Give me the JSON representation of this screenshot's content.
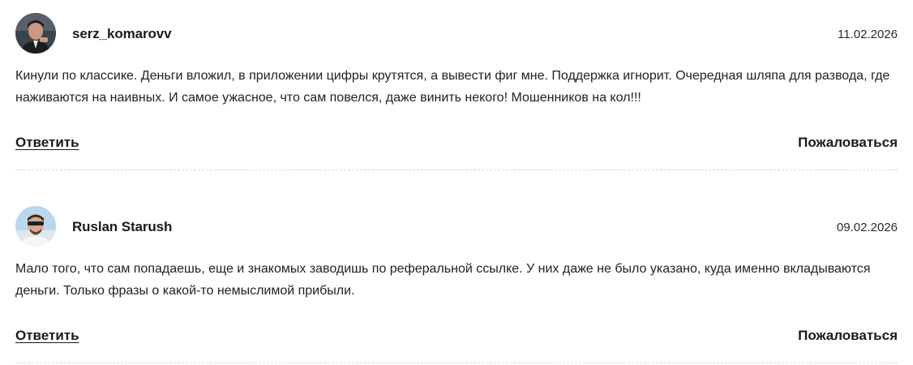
{
  "comments": [
    {
      "author": "serz_komarovv",
      "date": "11.02.2026",
      "text": "Кинули по классике. Деньги вложил, в приложении цифры крутятся, а вывести фиг мне. Поддержка игнорит. Очередная шляпа для развода, где наживаются на наивных. И самое ужасное, что сам повелся, даже винить некого! Мошенников на кол!!!",
      "reply_label": "Ответить",
      "report_label": "Пожаловаться"
    },
    {
      "author": "Ruslan Starush",
      "date": "09.02.2026",
      "text": "Мало того, что сам попадаешь, еще и знакомых заводишь по реферальной ссылке. У них даже не было указано, куда именно вкладываются деньги. Только фразы о какой-то немыслимой прибыли.",
      "reply_label": "Ответить",
      "report_label": "Пожаловаться"
    }
  ]
}
